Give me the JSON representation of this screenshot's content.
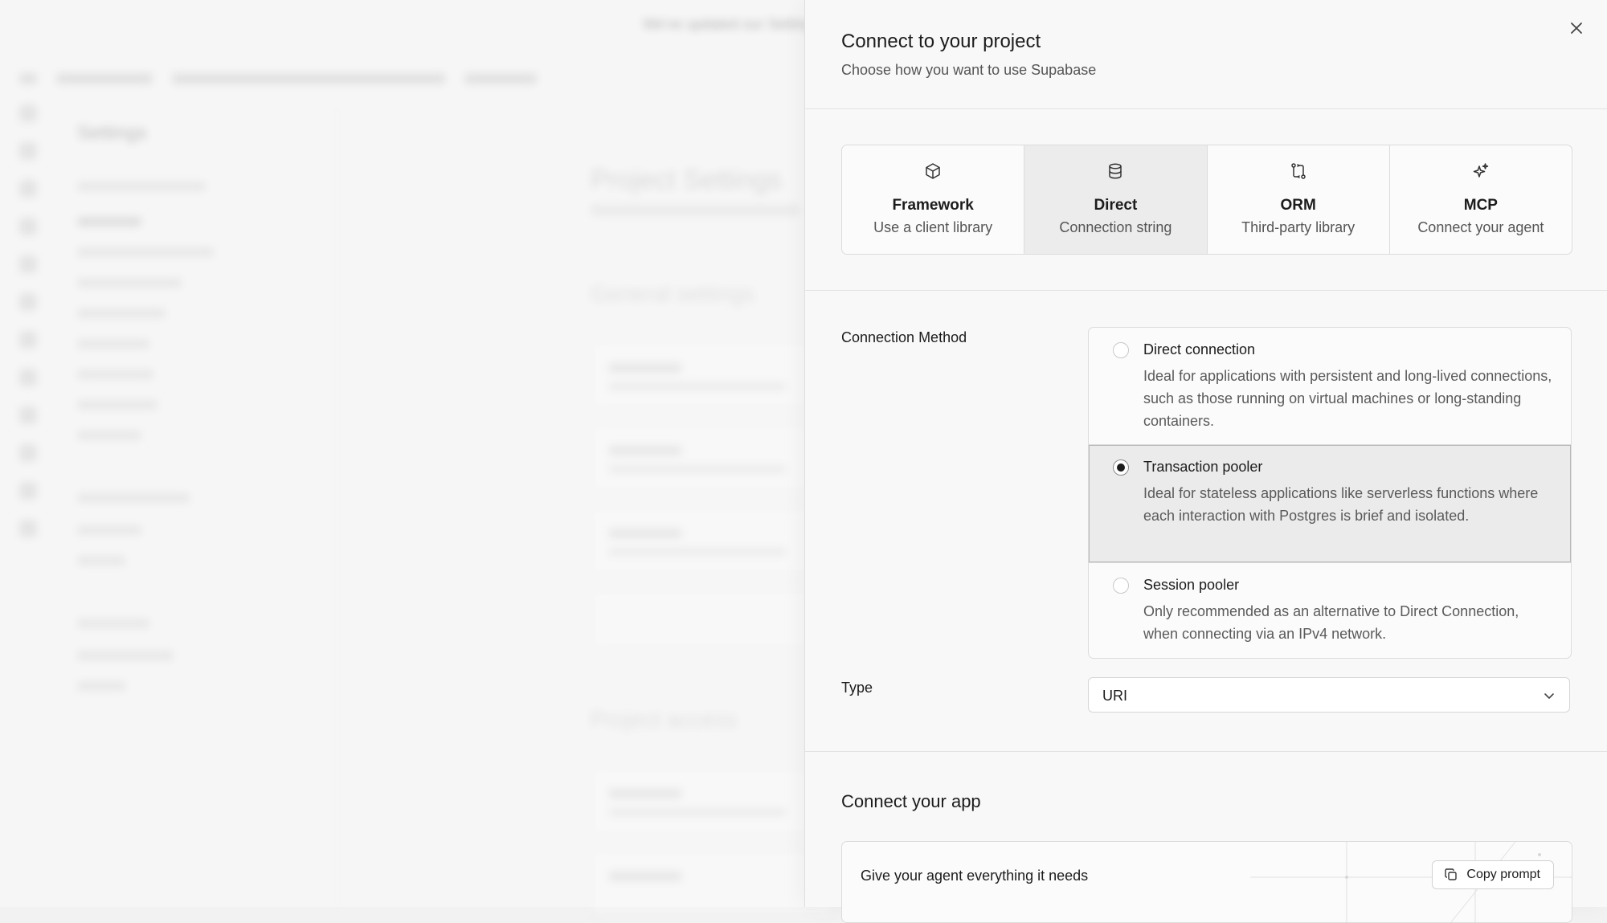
{
  "background": {
    "banner_text": "We've updated our Settings",
    "sidebar_title": "Settings",
    "page_title": "Project Settings",
    "section_title": "General settings",
    "section_title_2": "Project access"
  },
  "panel": {
    "title": "Connect to your project",
    "subtitle": "Choose how you want to use Supabase",
    "close_icon": "close-icon"
  },
  "tabs": [
    {
      "label": "Framework",
      "description": "Use a client library",
      "icon": "cube-icon",
      "selected": false
    },
    {
      "label": "Direct",
      "description": "Connection string",
      "icon": "database-icon",
      "selected": true
    },
    {
      "label": "ORM",
      "description": "Third-party library",
      "icon": "orm-icon",
      "selected": false
    },
    {
      "label": "MCP",
      "description": "Connect your agent",
      "icon": "sparkles-icon",
      "selected": false
    }
  ],
  "connection_method": {
    "label": "Connection Method",
    "options": [
      {
        "title": "Direct connection",
        "description": "Ideal for applications with persistent and long-lived connections, such as those running on virtual machines or long-standing containers.",
        "selected": false
      },
      {
        "title": "Transaction pooler",
        "description": "Ideal for stateless applications like serverless functions where each interaction with Postgres is brief and isolated.",
        "selected": true
      },
      {
        "title": "Session pooler",
        "description": "Only recommended as an alternative to Direct Connection, when connecting via an IPv4 network.",
        "selected": false
      }
    ]
  },
  "type": {
    "label": "Type",
    "value": "URI"
  },
  "connect_app": {
    "title": "Connect your app",
    "agent_text": "Give your agent everything it needs",
    "copy_button": "Copy prompt"
  },
  "colors": {
    "panel_bg": "#f8f8f8",
    "selected_bg": "#ebebeb",
    "text": "#1c1c1c",
    "muted": "#555555"
  }
}
